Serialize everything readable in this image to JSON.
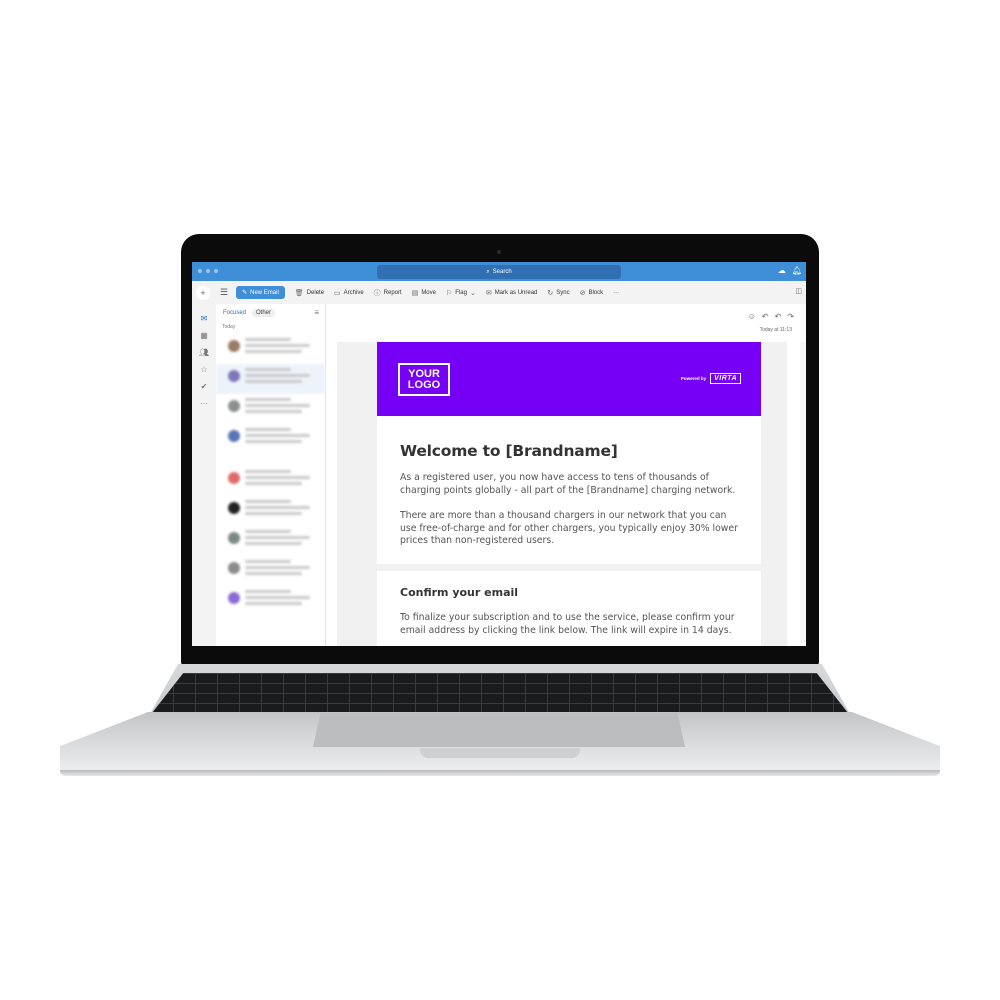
{
  "titlebar": {
    "search_label": "Search",
    "search_icon": "search-icon"
  },
  "toolbar": {
    "new_email": "New Email",
    "buttons": [
      {
        "label": "Delete",
        "icon": "trash-icon"
      },
      {
        "label": "Archive",
        "icon": "archive-icon"
      },
      {
        "label": "Report",
        "icon": "report-icon"
      },
      {
        "label": "Move",
        "icon": "folder-move-icon"
      },
      {
        "label": "Flag",
        "icon": "flag-icon"
      },
      {
        "label": "Mark as Unread",
        "icon": "envelope-icon"
      },
      {
        "label": "Sync",
        "icon": "sync-icon"
      },
      {
        "label": "Block",
        "icon": "block-user-icon"
      }
    ],
    "more": "···"
  },
  "rail": {
    "items": [
      "mail-icon",
      "calendar-icon",
      "people-icon",
      "star-icon",
      "todo-icon",
      "more-icon"
    ]
  },
  "message_list": {
    "tab_focused": "Focused",
    "tab_other": "Other",
    "group_today": "Today",
    "avatar_colors": [
      "#9b7b62",
      "#7e76b8",
      "#8c8f8e",
      "#5b73b8",
      "#e06a6a",
      "#222222",
      "#7a8a84",
      "#8a8a8a",
      "#8a6bd6"
    ]
  },
  "reading_pane": {
    "timestamp": "Today at 11:13",
    "email": {
      "banner_color": "#7500f5",
      "logo_text": "YOUR LOGO",
      "powered_by": "Powered by",
      "powered_brand": "VIRTA",
      "heading": "Welcome to [Brandname]",
      "para1": "As a registered user, you now have access to tens of thousands of charging points globally - all part of the [Brandname] charging network.",
      "para2": "There are more than a thousand chargers in our network that you can use free-of-charge and for other chargers, you typically enjoy 30% lower prices than non-registered users.",
      "confirm_heading": "Confirm your email",
      "confirm_text": "To finalize your subscription and to use the service, please confirm your email address by clicking the link below. The link will expire in 14 days."
    }
  }
}
